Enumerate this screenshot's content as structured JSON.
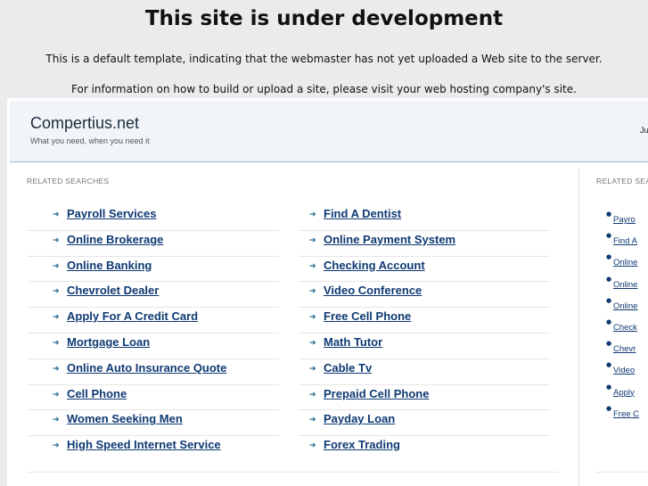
{
  "notice": {
    "title": "This site is under development",
    "line1": "This is a default template, indicating that the webmaster has not yet uploaded a Web site to the server.",
    "line2": "For information on how to build or upload a site, please visit your web hosting company's site."
  },
  "site": {
    "name": "Compertius.net",
    "tagline": "What you need, when you need it",
    "date_partial": "Ju"
  },
  "related": {
    "label": "RELATED SEARCHES",
    "left": [
      "Payroll Services",
      "Online Brokerage",
      "Online Banking",
      "Chevrolet Dealer",
      "Apply For A Credit Card",
      "Mortgage Loan",
      "Online Auto Insurance Quote",
      "Cell Phone",
      "Women Seeking Men",
      "High Speed Internet Service"
    ],
    "right": [
      "Find A Dentist",
      "Online Payment System",
      "Checking Account",
      "Video Conference",
      "Free Cell Phone",
      "Math Tutor",
      "Cable Tv",
      "Prepaid Cell Phone",
      "Payday Loan",
      "Forex Trading"
    ]
  },
  "sidebar": {
    "label": "RELATED SEA",
    "items": [
      "Payro",
      "Find A",
      "Online",
      "Online",
      "Online",
      "Check",
      "Chevr",
      "Video",
      "Apply",
      "Free C"
    ]
  },
  "icons": {
    "link_arrow": "arrow-right-icon",
    "bullet": "bullet-icon"
  },
  "colors": {
    "link": "#0f3a73",
    "header_bg": "#f1f5f9",
    "page_bg": "#ebebeb"
  }
}
